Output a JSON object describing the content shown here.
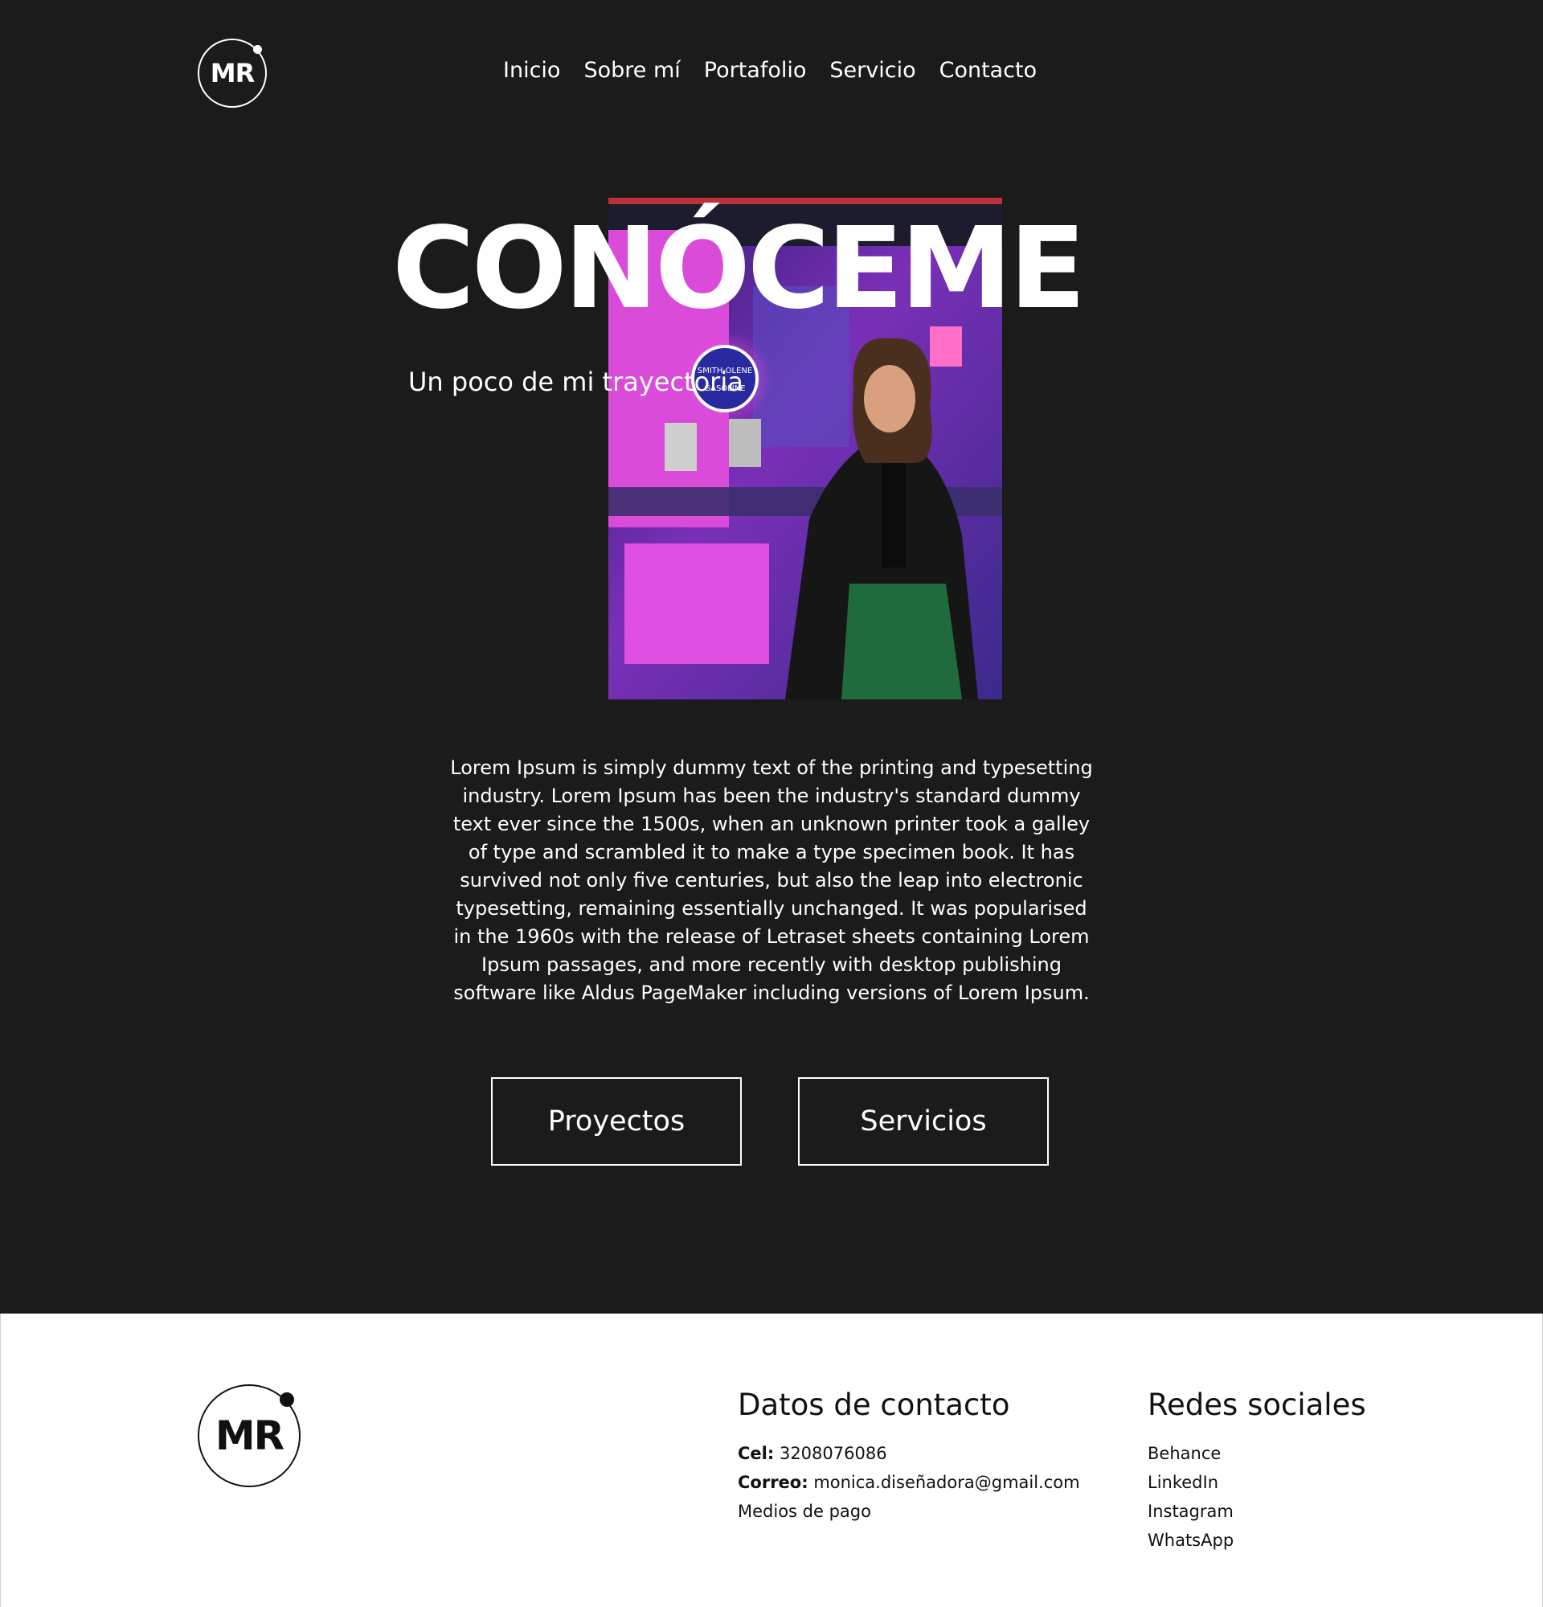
{
  "header": {
    "logo_text": "MR",
    "nav": [
      "Inicio",
      "Sobre mí",
      "Portafolio",
      "Servicio",
      "Contacto"
    ]
  },
  "hero": {
    "title": "CONÓCEME",
    "subtitle": "Un poco de mi trayectoria",
    "bio": "Lorem Ipsum is simply dummy text of the printing and typesetting industry. Lorem Ipsum has been the industry's standard dummy text ever since the 1500s, when an unknown printer took a galley of type and scrambled it to make a type specimen book. It has survived not only five centuries, but also the leap into electronic typesetting, remaining essentially unchanged. It was popularised in the 1960s with the release of Letraset sheets containing Lorem Ipsum passages, and more recently with desktop publishing software like Aldus PageMaker including versions of Lorem Ipsum.",
    "buttons": {
      "projects": "Proyectos",
      "services": "Servicios"
    },
    "photo_neon_sign": [
      "SMITH·OLENE",
      "GASOLINE"
    ]
  },
  "footer": {
    "logo_text": "MR",
    "contact": {
      "heading": "Datos de contacto",
      "phone_label": "Cel:",
      "phone": "3208076086",
      "email_label": "Correo:",
      "email": "monica.diseñadora@gmail.com",
      "payment": "Medios de pago"
    },
    "social": {
      "heading": "Redes sociales",
      "links": [
        "Behance",
        "LinkedIn",
        "Instagram",
        "WhatsApp"
      ]
    }
  },
  "colors": {
    "dark_bg": "#1b1b1b",
    "text_light": "#ffffff",
    "text_dark": "#111111",
    "accent_neon": "#e23bd8"
  }
}
